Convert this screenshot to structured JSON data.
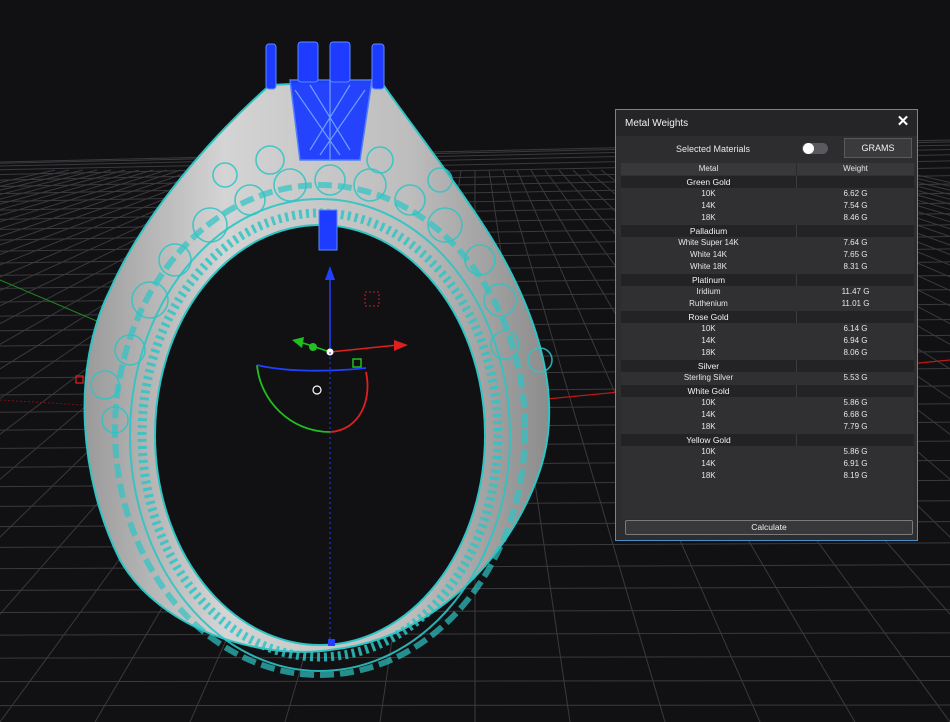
{
  "panel": {
    "title": "Metal Weights",
    "selected_materials_label": "Selected Materials",
    "toggle_on": false,
    "units_button": "GRAMS",
    "calculate_button": "Calculate",
    "columns": [
      "Metal",
      "Weight"
    ],
    "groups": [
      {
        "name": "Green Gold",
        "rows": [
          {
            "metal": "10K",
            "weight": "6.62 G"
          },
          {
            "metal": "14K",
            "weight": "7.54 G"
          },
          {
            "metal": "18K",
            "weight": "8.46 G"
          }
        ]
      },
      {
        "name": "Palladium",
        "rows": [
          {
            "metal": "White Super 14K",
            "weight": "7.64 G"
          },
          {
            "metal": "White 14K",
            "weight": "7.65 G"
          },
          {
            "metal": "White 18K",
            "weight": "8.31 G"
          }
        ]
      },
      {
        "name": "Platinum",
        "rows": [
          {
            "metal": "Iridium",
            "weight": "11.47 G"
          },
          {
            "metal": "Ruthenium",
            "weight": "11.01 G"
          }
        ]
      },
      {
        "name": "Rose Gold",
        "rows": [
          {
            "metal": "10K",
            "weight": "6.14 G"
          },
          {
            "metal": "14K",
            "weight": "6.94 G"
          },
          {
            "metal": "18K",
            "weight": "8.06 G"
          }
        ]
      },
      {
        "name": "Silver",
        "rows": [
          {
            "metal": "Sterling Silver",
            "weight": "5.53 G"
          }
        ]
      },
      {
        "name": "White Gold",
        "rows": [
          {
            "metal": "10K",
            "weight": "5.86 G"
          },
          {
            "metal": "14K",
            "weight": "6.68 G"
          },
          {
            "metal": "18K",
            "weight": "7.79 G"
          }
        ]
      },
      {
        "name": "Yellow Gold",
        "rows": [
          {
            "metal": "10K",
            "weight": "5.86 G"
          },
          {
            "metal": "14K",
            "weight": "6.91 G"
          },
          {
            "metal": "18K",
            "weight": "8.19 G"
          }
        ]
      }
    ]
  },
  "viewport": {
    "background_color": "#111113",
    "grid_color": "#3a3a3e",
    "model_wire_color": "#2ec4c4",
    "model_body_color": "#b8b8b8",
    "prongs_color": "#1d3cff",
    "axis_x_color": "#e02020",
    "axis_y_color": "#20c020",
    "axis_z_color": "#2040ff"
  }
}
